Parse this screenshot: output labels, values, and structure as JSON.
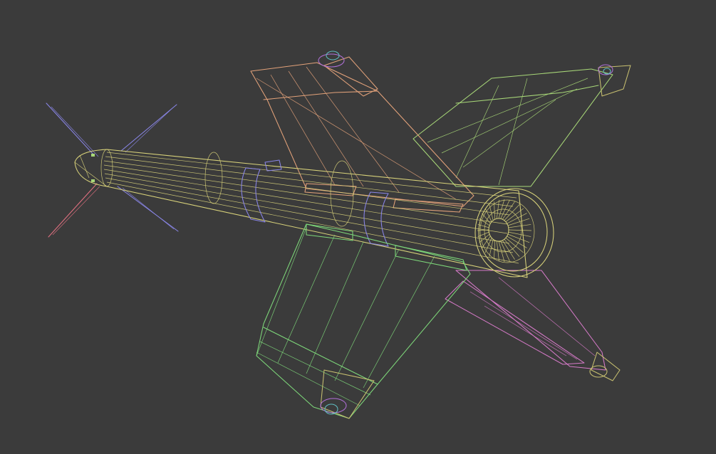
{
  "viewport": {
    "background": "#3b3b3b",
    "render_mode": "wireframe",
    "subject": "missile model"
  },
  "colors": {
    "body": "#d8d27a",
    "fin_top": "#e3a27a",
    "fin_right": "#a8d878",
    "fin_bottom": "#7ed87a",
    "fin_lower_right": "#d67ac8",
    "canard_blue": "#8a86e8",
    "canard_red": "#e07080",
    "band": "#8a86e8",
    "hub_teal": "#5fbcc0",
    "hub_purple": "#b070d8"
  }
}
